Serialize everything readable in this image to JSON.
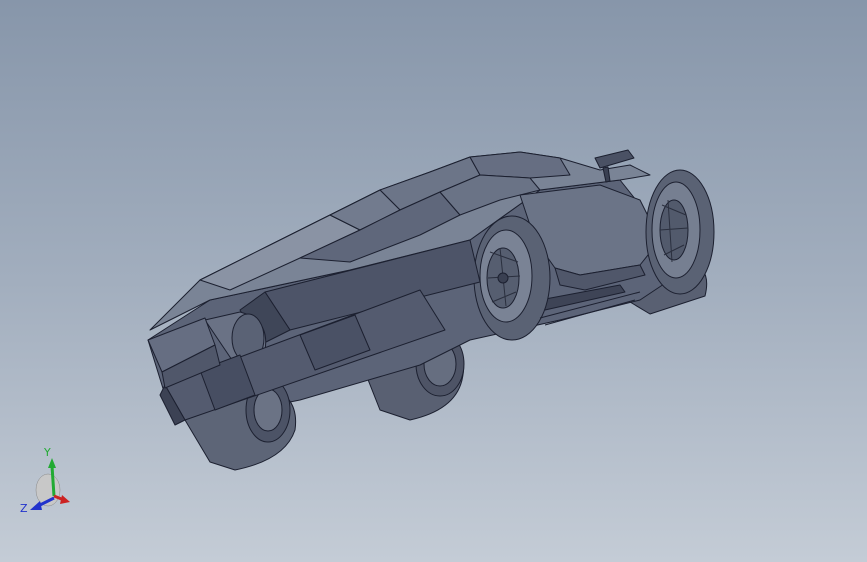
{
  "viewport": {
    "model_name": "sports-car-model",
    "render_style": "shaded-with-edges",
    "colors": {
      "background_top": "#8796aa",
      "background_bottom": "#c4ccd6",
      "body_light": "#727c8e",
      "body_mid": "#5a6276",
      "body_dark": "#454c5e",
      "tire": "#596072",
      "edge": "#1c2030"
    }
  },
  "triad": {
    "y_label": "Y",
    "z_label": "Z",
    "colors": {
      "x": "#cc2222",
      "y": "#22aa33",
      "z": "#2233cc"
    }
  }
}
